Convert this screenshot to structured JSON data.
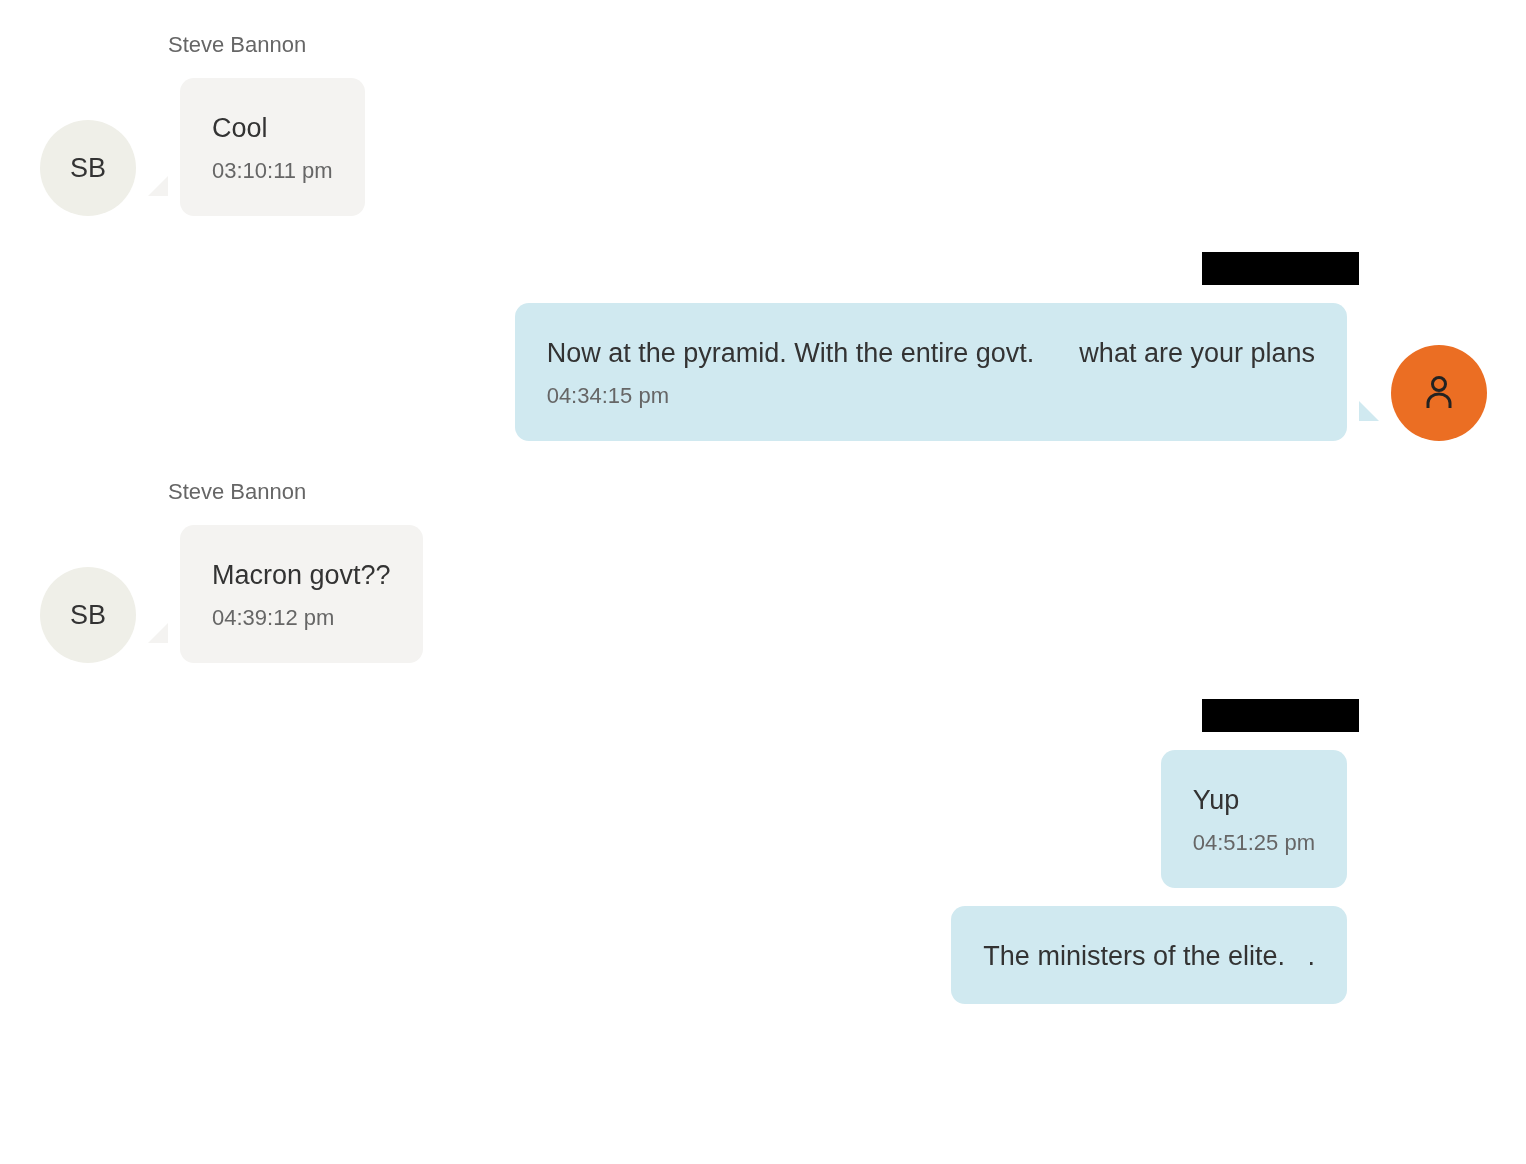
{
  "conversation": [
    {
      "kind": "incoming",
      "sender": "Steve Bannon",
      "avatar": {
        "kind": "initials",
        "text": "SB"
      },
      "messages": [
        {
          "text": "Cool",
          "time": "03:10:11 pm"
        }
      ]
    },
    {
      "kind": "outgoing",
      "sender_redacted": true,
      "avatar": {
        "kind": "user-icon"
      },
      "messages": [
        {
          "text": "Now at the pyramid. With the entire govt.      what are your plans",
          "time": "04:34:15 pm"
        }
      ]
    },
    {
      "kind": "incoming",
      "sender": "Steve Bannon",
      "avatar": {
        "kind": "initials",
        "text": "SB"
      },
      "messages": [
        {
          "text": "Macron govt??",
          "time": "04:39:12 pm"
        }
      ]
    },
    {
      "kind": "outgoing",
      "sender_redacted": true,
      "messages": [
        {
          "text": "Yup",
          "time": "04:51:25 pm"
        },
        {
          "text": "The ministers of the elite.   ."
        }
      ]
    }
  ]
}
